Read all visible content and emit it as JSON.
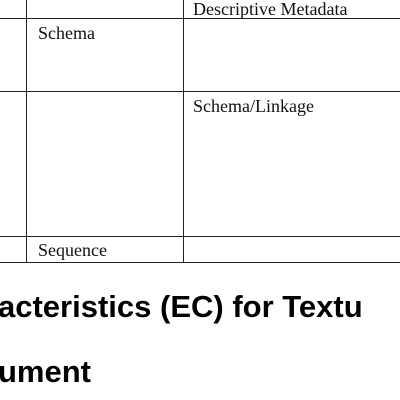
{
  "table": {
    "rows": [
      {
        "col_b": "",
        "col_c": "Descriptive Metadata"
      },
      {
        "col_b": "Schema",
        "col_c": ""
      },
      {
        "col_b": "",
        "col_c": "Schema/Linkage"
      },
      {
        "col_b": "Sequence",
        "col_c": ""
      }
    ]
  },
  "section_heading": {
    "line1": "acteristics (EC) for Textu",
    "line2": "ument"
  }
}
